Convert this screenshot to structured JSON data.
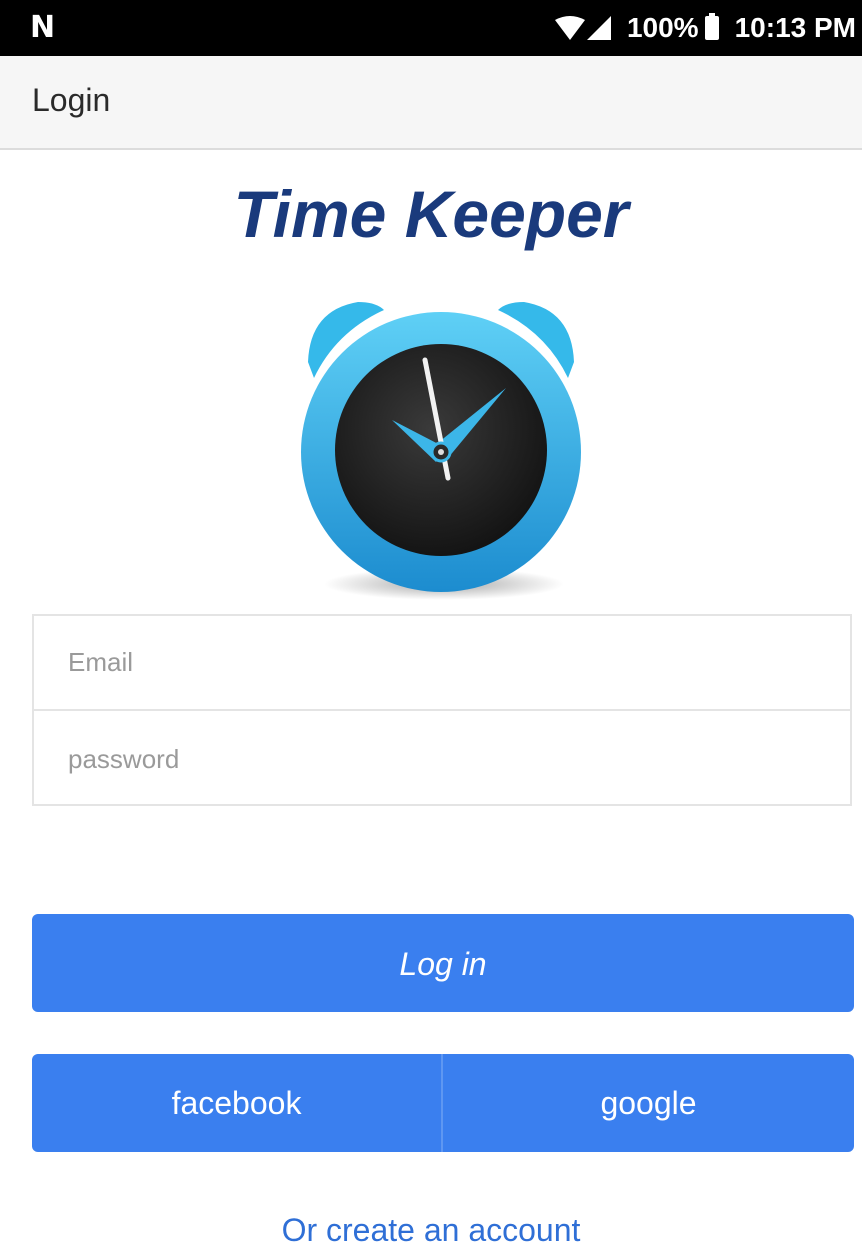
{
  "status_bar": {
    "notification_glyph": "N",
    "battery_percent": "100%",
    "time": "10:13 PM",
    "icons": [
      "wifi-icon",
      "signal-icon",
      "battery-charging-icon"
    ]
  },
  "app_bar": {
    "title": "Login"
  },
  "header": {
    "app_name": "Time Keeper"
  },
  "form": {
    "email": {
      "value": "",
      "placeholder": "Email"
    },
    "password": {
      "value": "",
      "placeholder": "password"
    }
  },
  "buttons": {
    "login_label": "Log in",
    "facebook_label": "facebook",
    "google_label": "google"
  },
  "footer": {
    "create_account_label": "Or create an account"
  },
  "colors": {
    "primary_button": "#3a7fef",
    "title": "#1a3a7c",
    "link": "#2f6fd6",
    "clock_ring": "#2fb3e8",
    "clock_face": "#1e1e1e"
  },
  "icons": {
    "logo": "alarm-clock-icon"
  }
}
